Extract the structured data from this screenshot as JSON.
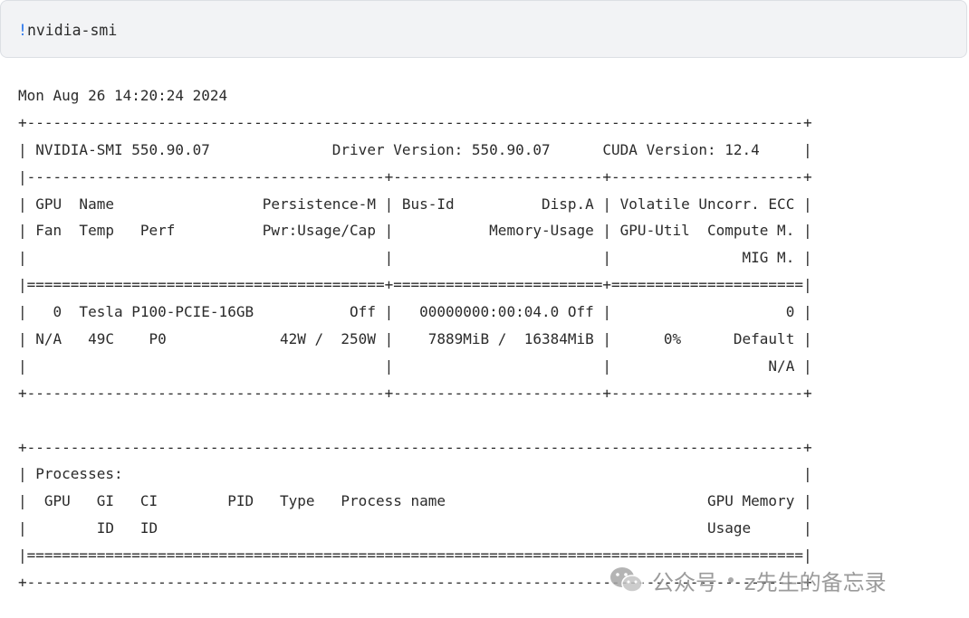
{
  "cell": {
    "bang": "!",
    "command": "nvidia-smi"
  },
  "output": {
    "lines": [
      "Mon Aug 26 14:20:24 2024",
      "+-----------------------------------------------------------------------------------------+",
      "| NVIDIA-SMI 550.90.07              Driver Version: 550.90.07      CUDA Version: 12.4     |",
      "|-----------------------------------------+------------------------+----------------------+",
      "| GPU  Name                 Persistence-M | Bus-Id          Disp.A | Volatile Uncorr. ECC |",
      "| Fan  Temp   Perf          Pwr:Usage/Cap |           Memory-Usage | GPU-Util  Compute M. |",
      "|                                         |                        |               MIG M. |",
      "|=========================================+========================+======================|",
      "|   0  Tesla P100-PCIE-16GB           Off |   00000000:00:04.0 Off |                    0 |",
      "| N/A   49C    P0             42W /  250W |    7889MiB /  16384MiB |      0%      Default |",
      "|                                         |                        |                  N/A |",
      "+-----------------------------------------+------------------------+----------------------+",
      "",
      "+-----------------------------------------------------------------------------------------+",
      "| Processes:                                                                              |",
      "|  GPU   GI   CI        PID   Type   Process name                              GPU Memory |",
      "|        ID   ID                                                               Usage      |",
      "|=========================================================================================|",
      "+-----------------------------------------------------------------------------------------+"
    ]
  },
  "watermark": {
    "account_label": "公众号",
    "account_name": "z先生的备忘录",
    "icon": "wechat-icon"
  }
}
